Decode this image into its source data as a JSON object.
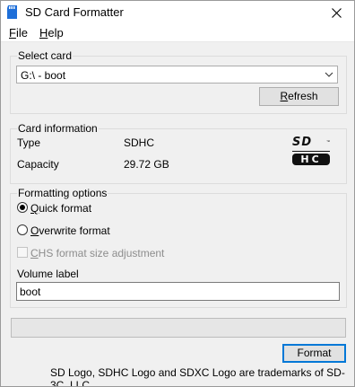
{
  "window": {
    "title": "SD Card Formatter"
  },
  "menu": [
    {
      "mnemonic": "F",
      "rest": "ile"
    },
    {
      "mnemonic": "H",
      "rest": "elp"
    }
  ],
  "select_card": {
    "group_label": "Select card",
    "selected": "G:\\ - boot",
    "refresh_mnemonic": "R",
    "refresh_rest": "efresh"
  },
  "card_info": {
    "group_label": "Card information",
    "type_label": "Type",
    "type_value": "SDHC",
    "capacity_label": "Capacity",
    "capacity_value": "29.72 GB",
    "logo_text_top": "SD",
    "logo_text_bottom": "HC"
  },
  "format_options": {
    "group_label": "Formatting options",
    "quick_mnemonic": "Q",
    "quick_rest": "uick format",
    "quick_checked": true,
    "overwrite_mnemonic": "O",
    "overwrite_rest": "verwrite format",
    "overwrite_checked": false,
    "chs_mnemonic": "C",
    "chs_rest": "HS format size adjustment",
    "chs_enabled": false,
    "volume_label": "Volume label",
    "volume_value": "boot"
  },
  "progress": {
    "fraction": 0
  },
  "actions": {
    "format_label": "Format"
  },
  "footer": {
    "text": "SD Logo, SDHC Logo and SDXC Logo are trademarks of SD-3C, LLC."
  }
}
